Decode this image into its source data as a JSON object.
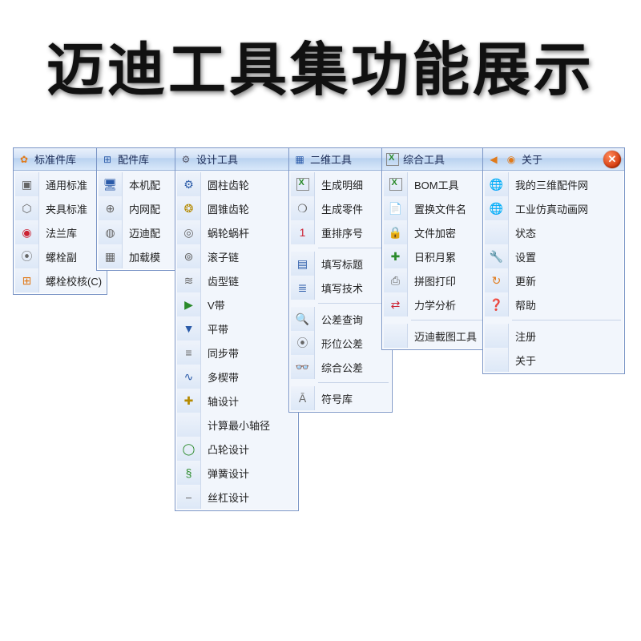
{
  "title": "迈迪工具集功能展示",
  "panels": {
    "std": {
      "header": "标准件库",
      "items": [
        "通用标准",
        "夹具标准",
        "法兰库",
        "螺栓副",
        "螺栓校核(C)"
      ]
    },
    "parts": {
      "header": "配件库",
      "items": [
        "本机配",
        "内网配",
        "迈迪配",
        "加载模"
      ]
    },
    "design": {
      "header": "设计工具",
      "items": [
        "圆柱齿轮",
        "圆锥齿轮",
        "蜗轮蜗杆",
        "滚子链",
        "齿型链",
        "V带",
        "平带",
        "同步带",
        "多楔带",
        "轴设计",
        "计算最小轴径",
        "凸轮设计",
        "弹簧设计",
        "丝杠设计"
      ]
    },
    "two_d": {
      "header": "二维工具",
      "items": [
        "生成明细",
        "生成零件",
        "重排序号",
        "填写标题",
        "填写技术",
        "公差查询",
        "形位公差",
        "综合公差",
        "符号库"
      ]
    },
    "integrated": {
      "header": "综合工具",
      "items": [
        "BOM工具",
        "置换文件名",
        "文件加密",
        "日积月累",
        "拼图打印",
        "力学分析",
        "迈迪截图工具"
      ]
    },
    "about": {
      "header": "关于",
      "items": [
        "我的三维配件网",
        "工业仿真动画网",
        "状态",
        "设置",
        "更新",
        "帮助",
        "注册",
        "关于"
      ]
    }
  },
  "close_label": "✕"
}
